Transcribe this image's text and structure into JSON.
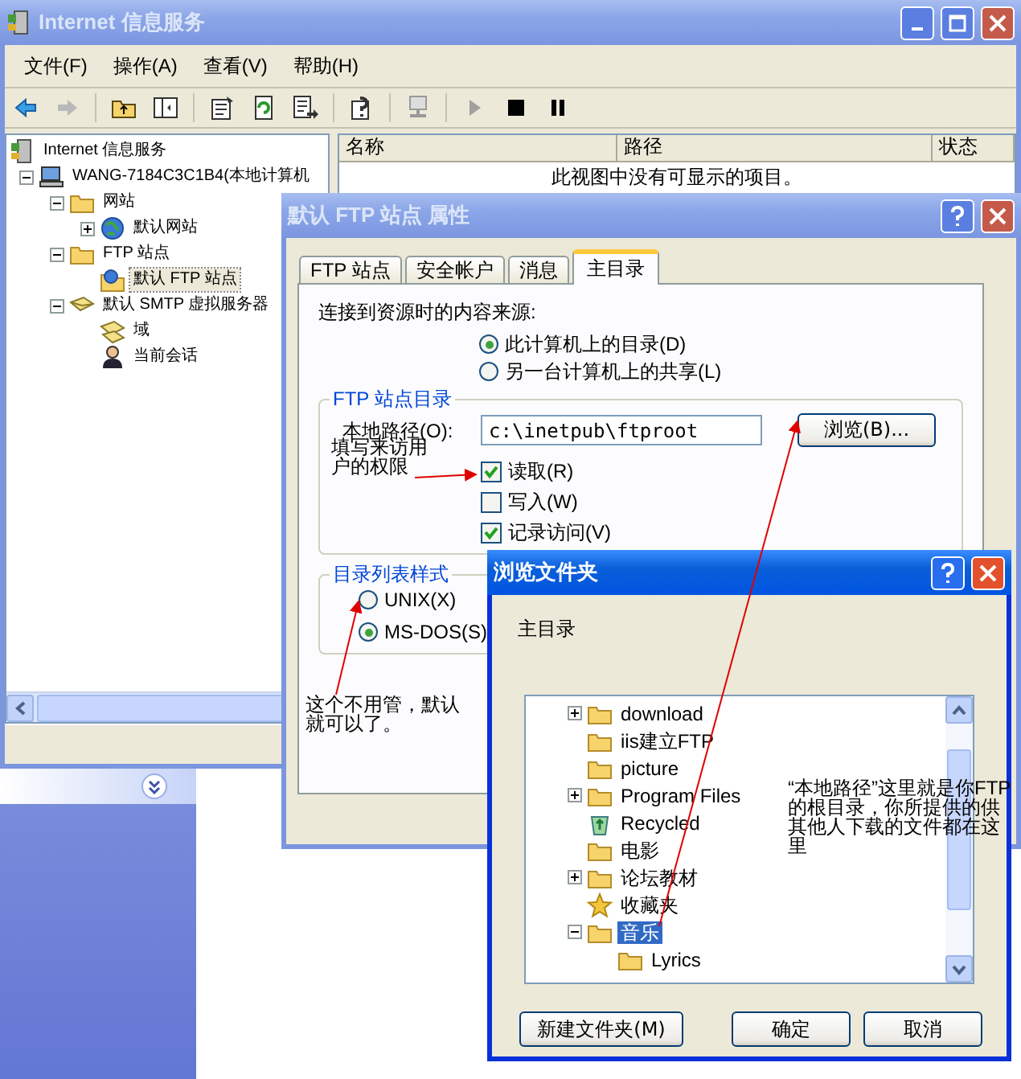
{
  "main_window": {
    "title": "Internet 信息服务",
    "menu": [
      "文件(F)",
      "操作(A)",
      "查看(V)",
      "帮助(H)"
    ],
    "tree": [
      {
        "label": "Internet 信息服务",
        "kind": "server",
        "selected": false,
        "children": [
          {
            "label": "WANG-7184C3C1B4(本地计算机",
            "kind": "computer",
            "expanded": true,
            "selected": false,
            "children": [
              {
                "label": "网站",
                "kind": "folder",
                "expanded": true,
                "selected": false,
                "children": [
                  {
                    "label": "默认网站",
                    "kind": "globe",
                    "expanded": false,
                    "selected": false
                  }
                ]
              },
              {
                "label": "FTP 站点",
                "kind": "folder",
                "expanded": true,
                "selected": false,
                "children": [
                  {
                    "label": "默认 FTP 站点",
                    "kind": "ftp",
                    "selected": true
                  }
                ]
              },
              {
                "label": "默认 SMTP 虚拟服务器",
                "kind": "smtp",
                "expanded": true,
                "selected": false,
                "children": [
                  {
                    "label": "域",
                    "kind": "domain",
                    "selected": false
                  },
                  {
                    "label": "当前会话",
                    "kind": "session",
                    "selected": false
                  }
                ]
              }
            ]
          }
        ]
      }
    ],
    "list": {
      "columns": [
        "名称",
        "路径",
        "状态"
      ],
      "empty_message": "此视图中没有可显示的项目。"
    }
  },
  "properties_dialog": {
    "title": "默认 FTP 站点 属性",
    "tabs": [
      {
        "label": "FTP 站点",
        "selected": false
      },
      {
        "label": "安全帐户",
        "selected": false
      },
      {
        "label": "消息",
        "selected": false
      },
      {
        "label": "主目录",
        "selected": true
      }
    ],
    "source_label": "连接到资源时的内容来源:",
    "source_options": [
      {
        "label": "此计算机上的目录(D)",
        "selected": true
      },
      {
        "label": "另一台计算机上的共享(L)",
        "selected": false
      }
    ],
    "directory_group": {
      "title": "FTP 站点目录",
      "path_label": "本地路径(O):",
      "path_value": "c:\\inetpub\\ftproot",
      "browse_button": "浏览(B)...",
      "permissions": [
        {
          "label": "读取(R)",
          "checked": true
        },
        {
          "label": "写入(W)",
          "checked": false
        },
        {
          "label": "记录访问(V)",
          "checked": true
        }
      ]
    },
    "listing_group": {
      "title": "目录列表样式",
      "options": [
        {
          "label": "UNIX(X)",
          "selected": false
        },
        {
          "label": "MS-DOS(S)",
          "selected": true
        }
      ]
    }
  },
  "browse_dialog": {
    "title": "浏览文件夹",
    "prompt": "主目录",
    "folders": [
      {
        "label": "download",
        "kind": "folder",
        "expanded": false,
        "selected": false
      },
      {
        "label": "iis建立FTP",
        "kind": "folder",
        "selected": false
      },
      {
        "label": "picture",
        "kind": "folder",
        "selected": false
      },
      {
        "label": "Program Files",
        "kind": "folder",
        "expanded": false,
        "selected": false
      },
      {
        "label": "Recycled",
        "kind": "recycle",
        "selected": false
      },
      {
        "label": "电影",
        "kind": "folder",
        "selected": false
      },
      {
        "label": "论坛教材",
        "kind": "folder",
        "expanded": false,
        "selected": false
      },
      {
        "label": "收藏夹",
        "kind": "star",
        "selected": false
      },
      {
        "label": "音乐",
        "kind": "folder",
        "expanded": true,
        "selected": true,
        "children": [
          {
            "label": "Lyrics",
            "kind": "folder",
            "selected": false
          }
        ]
      }
    ],
    "buttons": [
      "新建文件夹(M)",
      "确定",
      "取消"
    ]
  },
  "annotations": [
    "填写来访用户的权限",
    "这个不用管，默认就可以了。",
    "“本地路径”这里就是你FTP的根目录，你所提供的供其他人下载的文件都在这里"
  ]
}
